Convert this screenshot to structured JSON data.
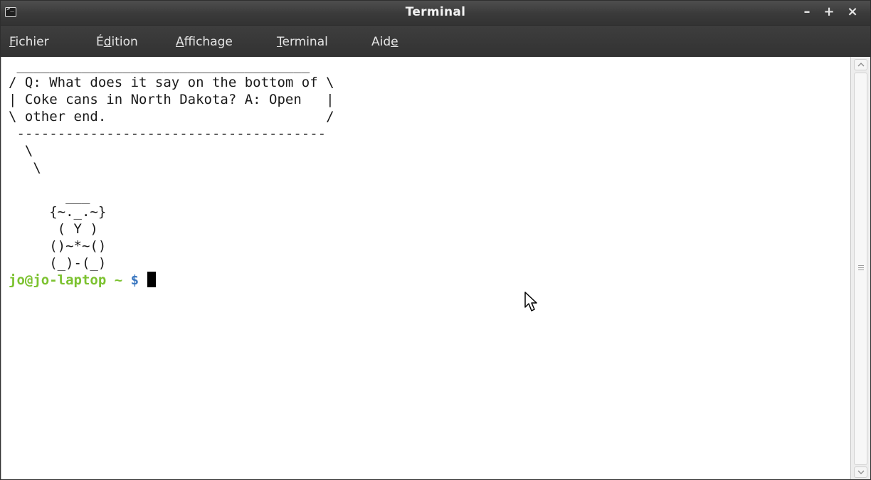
{
  "window": {
    "title": "Terminal",
    "icon": "terminal-app-icon",
    "icon_glyph": ">_",
    "controls": {
      "minimize": "–",
      "maximize": "+",
      "close": "×"
    }
  },
  "menubar": {
    "items": [
      {
        "name": "menu-fichier",
        "before": "",
        "mnemonic": "F",
        "after": "ichier"
      },
      {
        "name": "menu-edition",
        "before": "É",
        "mnemonic": "d",
        "after": "ition"
      },
      {
        "name": "menu-affichage",
        "before": "",
        "mnemonic": "A",
        "after": "ffichage"
      },
      {
        "name": "menu-terminal",
        "before": "",
        "mnemonic": "T",
        "after": "erminal"
      },
      {
        "name": "menu-aide",
        "before": "Aid",
        "mnemonic": "e",
        "after": ""
      }
    ]
  },
  "terminal": {
    "lines": [
      " ____________________________________",
      "/ Q: What does it say on the bottom of \\",
      "| Coke cans in North Dakota? A: Open   |",
      "\\ other end.                           /",
      " --------------------------------------",
      "  \\",
      "   \\",
      "       ___",
      "     {~._.~}",
      "      ( Y )",
      "     ()~*~()",
      "     (_)-(_)"
    ],
    "prompt": {
      "user_host": "jo@jo-laptop",
      "path": "~",
      "symbol": "$"
    }
  },
  "colors": {
    "titlebar_bg": "#3a3a3a",
    "prompt_user": "#7cc230",
    "prompt_symbol": "#3a77c0",
    "terminal_bg": "#ffffff",
    "terminal_fg": "#1a1a1a"
  },
  "icons": {
    "scroll_up": "scroll-up-arrow-icon",
    "scroll_down": "scroll-down-arrow-icon",
    "mouse": "mouse-pointer-icon"
  }
}
